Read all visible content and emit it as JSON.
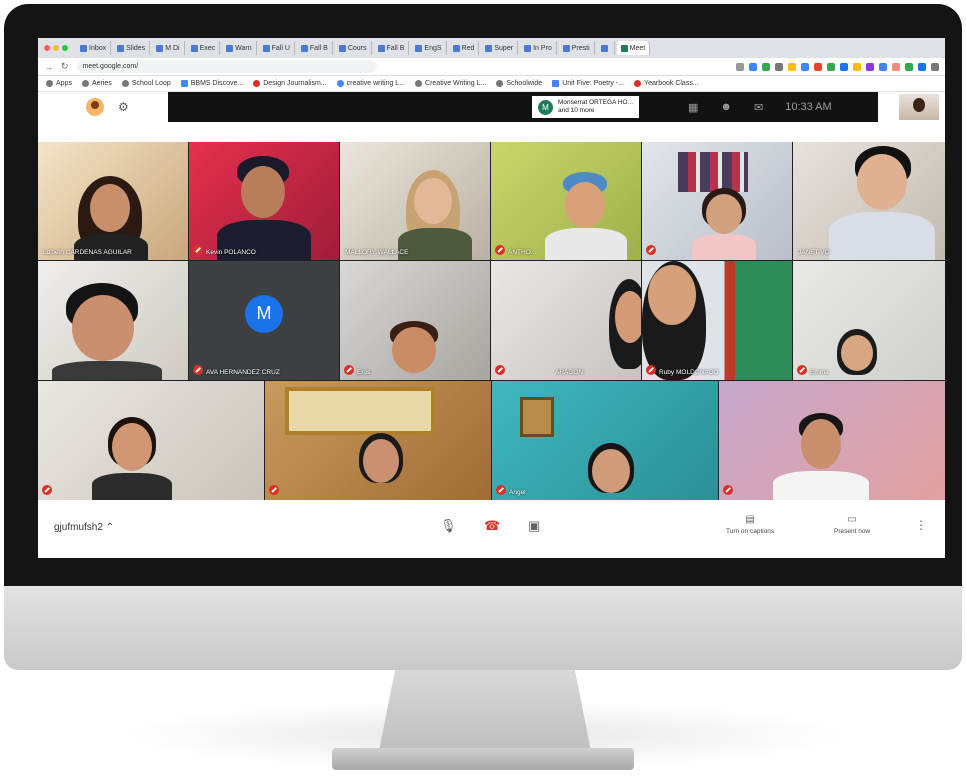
{
  "browser": {
    "tabs": [
      "Inbox",
      "Slides",
      "M Di",
      "Exec",
      "Warn",
      "Fall U",
      "Fall B",
      "Cours",
      "Fall B",
      "EngS",
      "Red",
      "Super",
      "In Pro",
      "Presti",
      "",
      "Meet"
    ],
    "url": "meet.google.com/",
    "bookmarks": [
      "Apps",
      "Aeries",
      "School Loop",
      "BBMS Discove...",
      "Design Journalism...",
      "creative writing L...",
      "Creative Writing L...",
      "Schoolwide",
      "Unit Five: Poetry -...",
      "Yearbook Class..."
    ]
  },
  "meet": {
    "notification": {
      "initial": "M",
      "line1": "Monserrat ORTEGA HO...",
      "line2": "and 10 more"
    },
    "clock": "10:33 AM",
    "meeting_code": "gjufmufsh2",
    "captions_label": "Turn on captions",
    "present_label": "Present now",
    "participants": [
      {
        "name": "Lizbeth CARDENAS AGUILAR",
        "muted": false
      },
      {
        "name": "Kevin POLANCO",
        "muted": true
      },
      {
        "name": "MALLORY WALLACE",
        "muted": false
      },
      {
        "name": "ANTHO...",
        "muted": true
      },
      {
        "name": "",
        "muted": true
      },
      {
        "name": "JANET VO",
        "muted": false
      },
      {
        "name": "",
        "muted": false
      },
      {
        "name": "AVA HERNANDEZ CRUZ",
        "muted": true,
        "avatar_initial": "M"
      },
      {
        "name": "Eros",
        "muted": true
      },
      {
        "name": "ARAGON",
        "muted": true
      },
      {
        "name": "Ruby MOLDONADO",
        "muted": true
      },
      {
        "name": "Emma",
        "muted": true
      },
      {
        "name": "",
        "muted": true
      },
      {
        "name": "",
        "muted": true
      },
      {
        "name": "Angel",
        "muted": true
      },
      {
        "name": "",
        "muted": true
      }
    ]
  },
  "colors": {
    "bezel": "#141414",
    "mute_red": "#d93025",
    "avatar_blue": "#1a73e8",
    "google_green": "#1e7e5a"
  },
  "icons": [
    "mic-icon",
    "hangup-icon",
    "camera-icon",
    "captions-icon",
    "present-icon",
    "more-icon"
  ]
}
